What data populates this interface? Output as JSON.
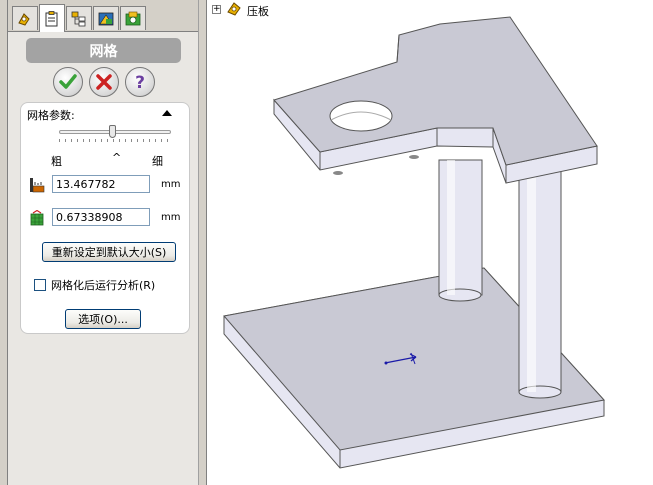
{
  "tabs": [
    {
      "icon": "feature-manager-icon",
      "active": false
    },
    {
      "icon": "property-manager-icon",
      "active": true
    },
    {
      "icon": "configuration-manager-icon",
      "active": false
    },
    {
      "icon": "dimxpert-manager-icon",
      "active": false
    },
    {
      "icon": "simulation-study-icon",
      "active": false
    }
  ],
  "panel": {
    "title": "网格",
    "ok_icon": "checkmark-icon",
    "cancel_icon": "x-icon",
    "help_icon": "question-icon"
  },
  "mesh_params": {
    "header": "网格参数:",
    "slider_fraction": 0.48,
    "coarse_label": "粗",
    "fine_label": "细",
    "caret": "^",
    "global_size": "13.467782",
    "tolerance": "0.67338908",
    "unit": "mm",
    "reset_button": "重新设定到默认大小(S)",
    "run_after_label": "网格化后运行分析(R)",
    "run_after_checked": false,
    "options_button": "选项(O)..."
  },
  "tree": {
    "expand_glyph": "+",
    "root_label": "压板"
  },
  "colors": {
    "model_top": "#c9c9d4",
    "model_side": "#e6e6f2",
    "panel_bg": "#e9e7e3",
    "ok_green": "#3aa33a",
    "cancel_red": "#cc2222",
    "help_purple": "#6b3fa0"
  }
}
